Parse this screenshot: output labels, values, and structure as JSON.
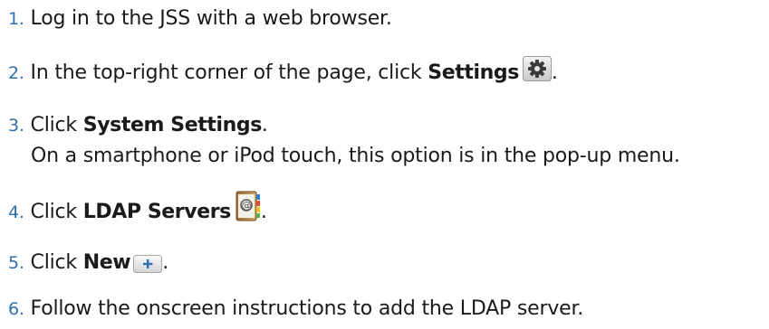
{
  "steps": [
    {
      "number": "1.",
      "text": "Log in to the JSS with a web browser."
    },
    {
      "number": "2.",
      "text_before": "In the top-right corner of the page, click ",
      "bold": "Settings",
      "text_after": ".",
      "icon": "gear-icon"
    },
    {
      "number": "3.",
      "text_before": "Click ",
      "bold": "System Settings",
      "text_after": ".",
      "subtext": "On a smartphone or iPod touch, this option is in the pop-up menu."
    },
    {
      "number": "4.",
      "text_before": "Click ",
      "bold": "LDAP Servers",
      "text_after": ".",
      "icon": "address-book-icon"
    },
    {
      "number": "5.",
      "text_before": "Click ",
      "bold": "New",
      "text_after": ".",
      "icon": "plus-button-icon"
    },
    {
      "number": "6.",
      "text": "Follow the onscreen instructions to add the LDAP server."
    }
  ],
  "colors": {
    "number": "#2f6fae",
    "text": "#1a1a1a"
  }
}
